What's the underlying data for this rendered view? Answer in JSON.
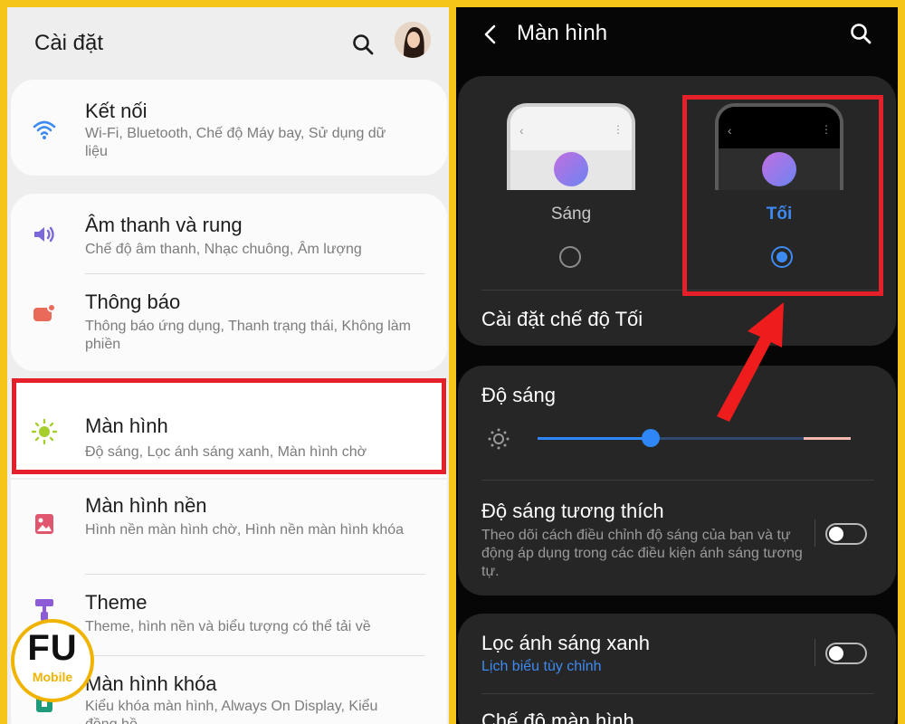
{
  "left_panel": {
    "title": "Cài đặt",
    "items": [
      {
        "title": "Kết nối",
        "subtitle": "Wi-Fi, Bluetooth, Chế độ Máy bay, Sử dụng dữ liệu"
      },
      {
        "title": "Âm thanh và rung",
        "subtitle": "Chế độ âm thanh, Nhạc chuông, Âm lượng"
      },
      {
        "title": "Thông báo",
        "subtitle": "Thông báo ứng dụng, Thanh trạng thái, Không làm phiền"
      },
      {
        "title": "Màn hình",
        "subtitle": "Độ sáng, Lọc ánh sáng xanh, Màn hình chờ"
      },
      {
        "title": "Màn hình nền",
        "subtitle": "Hình nền màn hình chờ, Hình nền màn hình khóa"
      },
      {
        "title": "Theme",
        "subtitle": "Theme, hình nền và biểu tượng có thể tải về"
      },
      {
        "title": "Màn hình khóa",
        "subtitle": "Kiểu khóa màn hình, Always On Display, Kiểu đồng hồ"
      }
    ]
  },
  "right_panel": {
    "title": "Màn hình",
    "themes": {
      "light_label": "Sáng",
      "dark_label": "Tối",
      "selected": "Tối"
    },
    "dark_mode_settings": "Cài đặt chế độ Tối",
    "brightness": {
      "label": "Độ sáng",
      "level": 0.36
    },
    "adaptive_brightness": {
      "label": "Độ sáng tương thích",
      "description": "Theo dõi cách điều chỉnh độ sáng của bạn và tự động áp dụng trong các điều kiện ánh sáng tương tự.",
      "enabled": false
    },
    "blue_light_filter": {
      "label": "Lọc ánh sáng xanh",
      "schedule": "Lịch biểu tùy chỉnh",
      "enabled": false
    },
    "screen_mode": "Chế độ màn hình"
  },
  "logo": {
    "main": "FU",
    "sub": "Mobile"
  },
  "colors": {
    "frame": "#f5c518",
    "highlight_red": "#e5202a",
    "accent_blue": "#3d8bf2"
  }
}
